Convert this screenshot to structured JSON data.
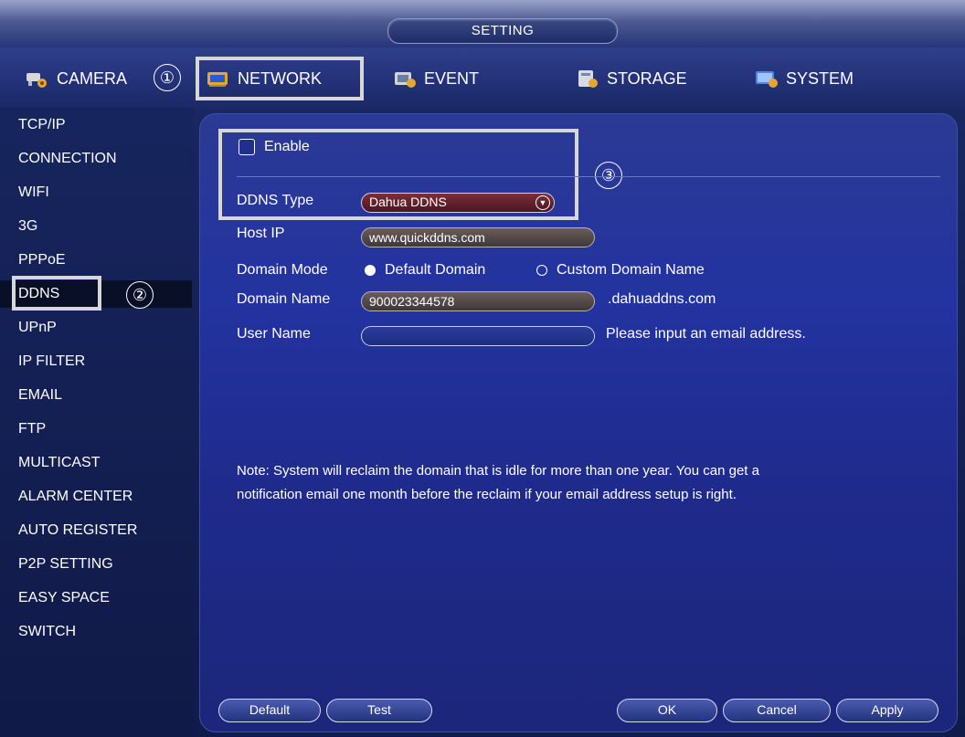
{
  "window": {
    "title": "SETTING"
  },
  "tabs": [
    {
      "label": "CAMERA",
      "icon": "camera-icon",
      "active": false
    },
    {
      "label": "NETWORK",
      "icon": "network-icon",
      "active": true
    },
    {
      "label": "EVENT",
      "icon": "event-icon",
      "active": false
    },
    {
      "label": "STORAGE",
      "icon": "storage-icon",
      "active": false
    },
    {
      "label": "SYSTEM",
      "icon": "system-icon",
      "active": false
    }
  ],
  "callouts": {
    "one": "①",
    "two": "②",
    "three": "③"
  },
  "sidebar": {
    "items": [
      "TCP/IP",
      "CONNECTION",
      "WIFI",
      "3G",
      "PPPoE",
      "DDNS",
      "UPnP",
      "IP FILTER",
      "EMAIL",
      "FTP",
      "MULTICAST",
      "ALARM CENTER",
      "AUTO REGISTER",
      "P2P SETTING",
      "EASY SPACE",
      "SWITCH"
    ],
    "active": "DDNS"
  },
  "form": {
    "enable_label": "Enable",
    "enabled": false,
    "ddns_type_label": "DDNS Type",
    "ddns_type_value": "Dahua DDNS",
    "host_ip_label": "Host IP",
    "host_ip_value": "www.quickddns.com",
    "domain_mode_label": "Domain Mode",
    "domain_mode_default": "Default Domain",
    "domain_mode_custom": "Custom Domain Name",
    "domain_mode_selected": "Default Domain",
    "domain_name_label": "Domain Name",
    "domain_name_value": "900023344578",
    "domain_suffix": ".dahuaddns.com",
    "user_name_label": "User Name",
    "user_name_value": "",
    "user_name_hint": "Please input an email address.",
    "note_line1": "Note: System will reclaim the domain that is idle for more than one year. You can get a",
    "note_line2": "notification email one month before the reclaim if your email address setup is right."
  },
  "buttons": {
    "default": "Default",
    "test": "Test",
    "ok": "OK",
    "cancel": "Cancel",
    "apply": "Apply"
  },
  "colors": {
    "panel": "#2333a0",
    "field_fill": "#5a4f4f",
    "highlight_box": "#d7d7d7"
  }
}
